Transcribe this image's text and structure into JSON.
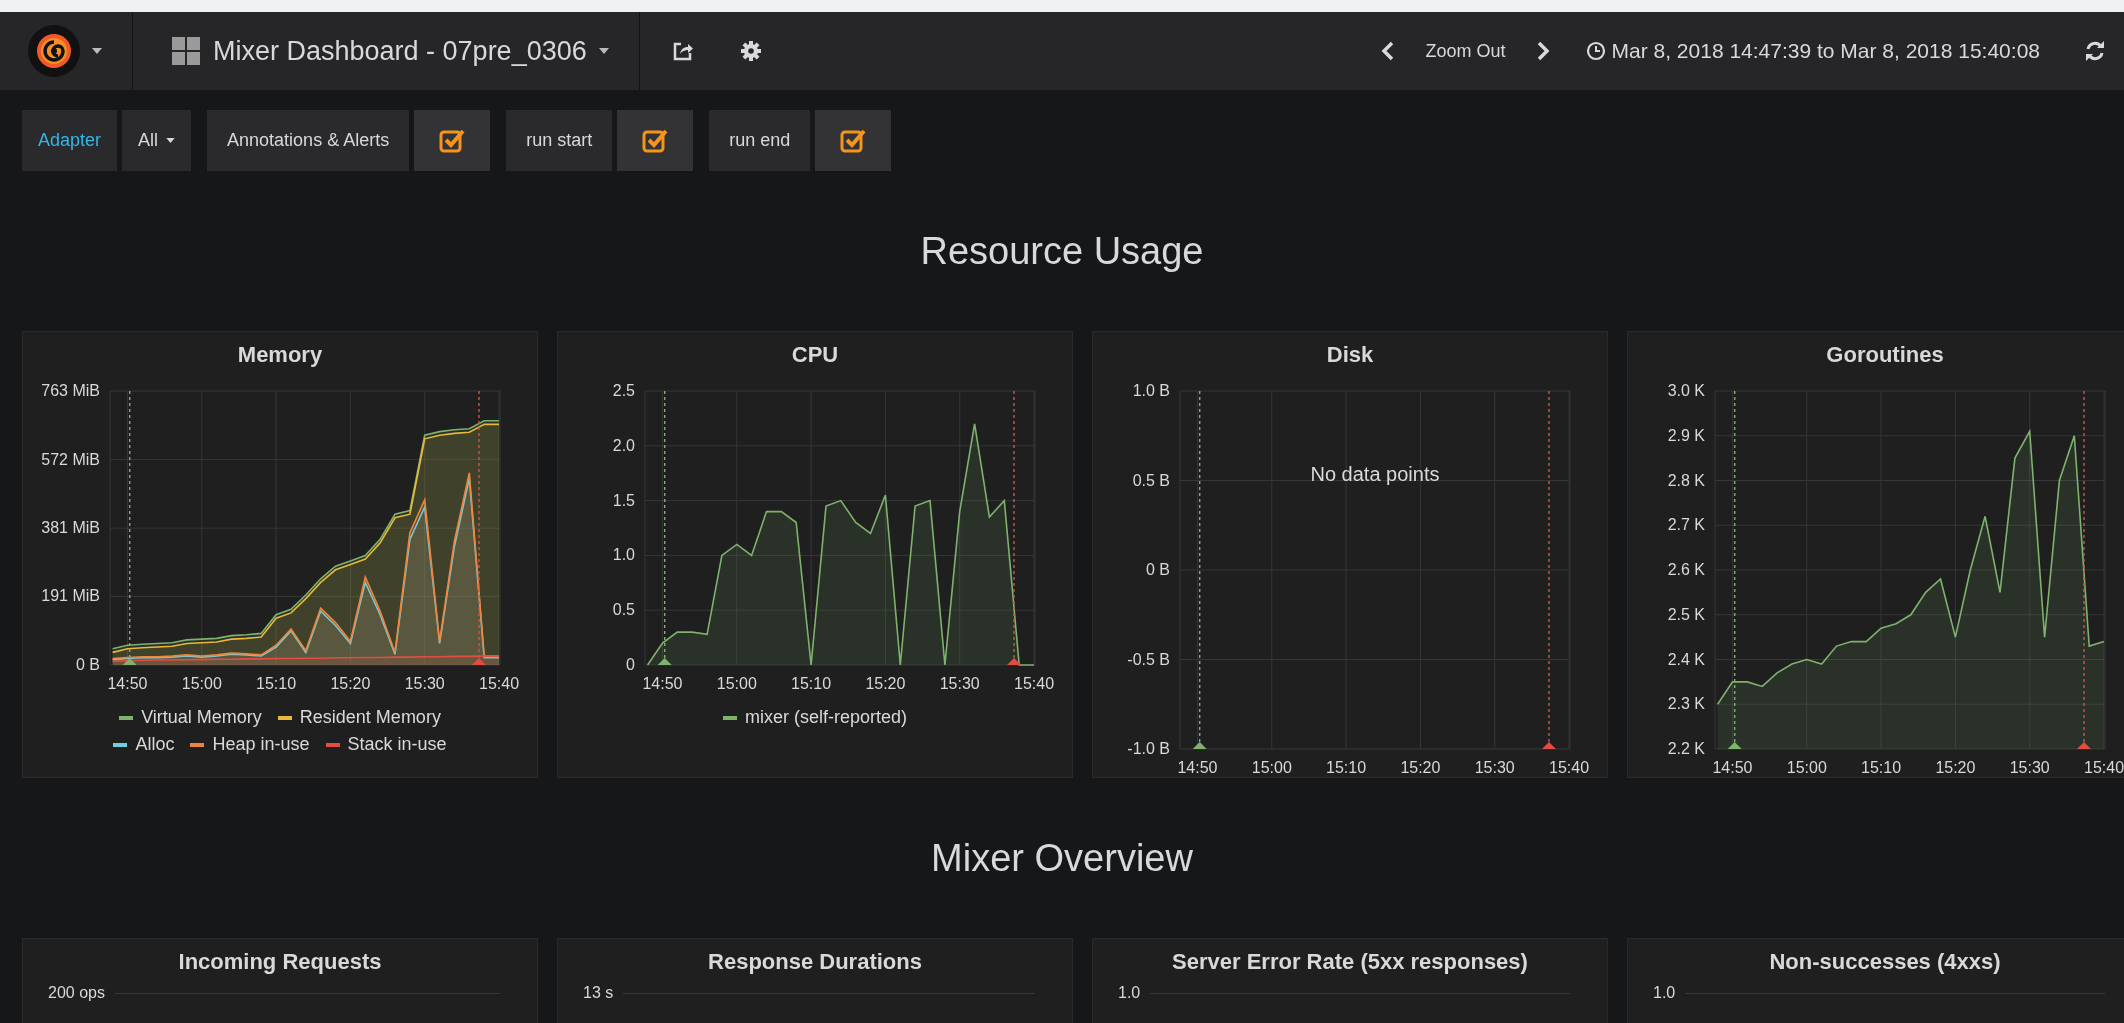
{
  "navbar": {
    "dashboard_title": "Mixer Dashboard - 07pre_0306",
    "zoom_out": "Zoom Out",
    "time_range": "Mar 8, 2018 14:47:39 to Mar 8, 2018 15:40:08"
  },
  "variables": [
    {
      "label": "Adapter",
      "value": "All"
    }
  ],
  "annotation_toggles": [
    {
      "label": "Annotations & Alerts",
      "checked": true
    },
    {
      "label": "run start",
      "checked": true
    },
    {
      "label": "run end",
      "checked": true
    }
  ],
  "sections": [
    {
      "title": "Resource Usage",
      "panels": [
        {
          "title": "Memory",
          "chart_data": {
            "type": "area",
            "grid": true,
            "categories": [
              null,
              "14:50",
              null,
              null,
              null,
              null,
              "15:00",
              null,
              null,
              null,
              null,
              "15:10",
              null,
              null,
              null,
              null,
              "15:20",
              null,
              null,
              null,
              null,
              "15:30",
              null,
              null,
              null,
              null,
              "15:40"
            ],
            "ylim": [
              0,
              763
            ],
            "yticks": [
              {
                "value": 0,
                "label": "0 B"
              },
              {
                "value": 191,
                "label": "191 MiB"
              },
              {
                "value": 381,
                "label": "381 MiB"
              },
              {
                "value": 572,
                "label": "572 MiB"
              },
              {
                "value": 763,
                "label": "763 MiB"
              }
            ],
            "series": [
              {
                "name": "Virtual Memory",
                "color": "#7eb26d",
                "values": [
                  45,
                  55,
                  58,
                  60,
                  62,
                  70,
                  72,
                  74,
                  82,
                  84,
                  88,
                  140,
                  155,
                  195,
                  240,
                  275,
                  290,
                  305,
                  350,
                  420,
                  430,
                  640,
                  650,
                  655,
                  658,
                  680,
                  680
                ]
              },
              {
                "name": "Resident Memory",
                "color": "#eab839",
                "values": [
                  35,
                  45,
                  48,
                  50,
                  52,
                  60,
                  62,
                  64,
                  72,
                  74,
                  78,
                  130,
                  145,
                  185,
                  230,
                  265,
                  280,
                  295,
                  340,
                  410,
                  420,
                  630,
                  640,
                  645,
                  648,
                  670,
                  670
                ]
              },
              {
                "name": "Alloc",
                "color": "#6ed0e0",
                "values": [
                  15,
                  18,
                  20,
                  20,
                  22,
                  25,
                  22,
                  25,
                  30,
                  28,
                  25,
                  50,
                  95,
                  35,
                  150,
                  110,
                  60,
                  230,
                  140,
                  30,
                  350,
                  440,
                  60,
                  330,
                  520,
                  20,
                  20
                ]
              },
              {
                "name": "Heap in-use",
                "color": "#ef843c",
                "values": [
                  18,
                  21,
                  23,
                  23,
                  25,
                  28,
                  25,
                  28,
                  33,
                  31,
                  28,
                  55,
                  100,
                  40,
                  158,
                  118,
                  66,
                  245,
                  150,
                  35,
                  368,
                  460,
                  66,
                  345,
                  535,
                  25,
                  25
                ]
              },
              {
                "name": "Stack in-use",
                "color": "#e24d42",
                "values": [
                  10,
                  12,
                  13,
                  14,
                  14,
                  15,
                  15,
                  16,
                  16,
                  17,
                  17,
                  18,
                  18,
                  19,
                  19,
                  20,
                  20,
                  21,
                  21,
                  22,
                  22,
                  23,
                  23,
                  24,
                  24,
                  25,
                  25
                ]
              }
            ]
          }
        },
        {
          "title": "CPU",
          "chart_data": {
            "type": "area",
            "grid": true,
            "categories": [
              null,
              "14:50",
              null,
              null,
              null,
              null,
              "15:00",
              null,
              null,
              null,
              null,
              "15:10",
              null,
              null,
              null,
              null,
              "15:20",
              null,
              null,
              null,
              null,
              "15:30",
              null,
              null,
              null,
              null,
              "15:40"
            ],
            "ylim": [
              0,
              2.5
            ],
            "yticks": [
              {
                "value": 0,
                "label": "0"
              },
              {
                "value": 0.5,
                "label": "0.5"
              },
              {
                "value": 1,
                "label": "1.0"
              },
              {
                "value": 1.5,
                "label": "1.5"
              },
              {
                "value": 2,
                "label": "2.0"
              },
              {
                "value": 2.5,
                "label": "2.5"
              }
            ],
            "series": [
              {
                "name": "mixer (self-reported)",
                "color": "#7eb26d",
                "values": [
                  0,
                  0.2,
                  0.3,
                  0.3,
                  0.28,
                  1.0,
                  1.1,
                  1.0,
                  1.4,
                  1.4,
                  1.3,
                  0,
                  1.45,
                  1.5,
                  1.3,
                  1.2,
                  1.55,
                  0,
                  1.45,
                  1.5,
                  0,
                  1.4,
                  2.2,
                  1.35,
                  1.5,
                  0,
                  0
                ]
              }
            ]
          }
        },
        {
          "title": "Disk",
          "message": "No data points",
          "chart_data": {
            "type": "line",
            "grid": true,
            "categories": [
              null,
              "14:50",
              null,
              null,
              null,
              null,
              "15:00",
              null,
              null,
              null,
              null,
              "15:10",
              null,
              null,
              null,
              null,
              "15:20",
              null,
              null,
              null,
              null,
              "15:30",
              null,
              null,
              null,
              null,
              "15:40"
            ],
            "ylim": [
              -1,
              1
            ],
            "yticks": [
              {
                "value": -1,
                "label": "-1.0 B"
              },
              {
                "value": -0.5,
                "label": "-0.5 B"
              },
              {
                "value": 0,
                "label": "0 B"
              },
              {
                "value": 0.5,
                "label": "0.5 B"
              },
              {
                "value": 1,
                "label": "1.0 B"
              }
            ]
          }
        },
        {
          "title": "Goroutines",
          "chart_data": {
            "type": "area",
            "grid": true,
            "categories": [
              null,
              "14:50",
              null,
              null,
              null,
              null,
              "15:00",
              null,
              null,
              null,
              null,
              "15:10",
              null,
              null,
              null,
              null,
              "15:20",
              null,
              null,
              null,
              null,
              "15:30",
              null,
              null,
              null,
              null,
              "15:40"
            ],
            "ylim": [
              2.2,
              3.0
            ],
            "yticks": [
              {
                "value": 2.2,
                "label": "2.2 K"
              },
              {
                "value": 2.3,
                "label": "2.3 K"
              },
              {
                "value": 2.4,
                "label": "2.4 K"
              },
              {
                "value": 2.5,
                "label": "2.5 K"
              },
              {
                "value": 2.6,
                "label": "2.6 K"
              },
              {
                "value": 2.7,
                "label": "2.7 K"
              },
              {
                "value": 2.8,
                "label": "2.8 K"
              },
              {
                "value": 2.9,
                "label": "2.9 K"
              },
              {
                "value": 3.0,
                "label": "3.0 K"
              }
            ],
            "series": [
              {
                "color": "#7eb26d",
                "values": [
                  2.3,
                  2.35,
                  2.35,
                  2.34,
                  2.37,
                  2.39,
                  2.4,
                  2.39,
                  2.43,
                  2.44,
                  2.44,
                  2.47,
                  2.48,
                  2.5,
                  2.55,
                  2.58,
                  2.45,
                  2.6,
                  2.72,
                  2.55,
                  2.85,
                  2.91,
                  2.45,
                  2.8,
                  2.9,
                  2.43,
                  2.44
                ]
              }
            ]
          }
        }
      ]
    },
    {
      "title": "Mixer Overview",
      "panels": [
        {
          "title": "Incoming Requests",
          "top_tick": "200 ops"
        },
        {
          "title": "Response Durations",
          "top_tick": "13 s"
        },
        {
          "title": "Server Error Rate (5xx responses)",
          "top_tick": "1.0"
        },
        {
          "title": "Non-successes (4xxs)",
          "top_tick": "1.0"
        }
      ]
    }
  ]
}
